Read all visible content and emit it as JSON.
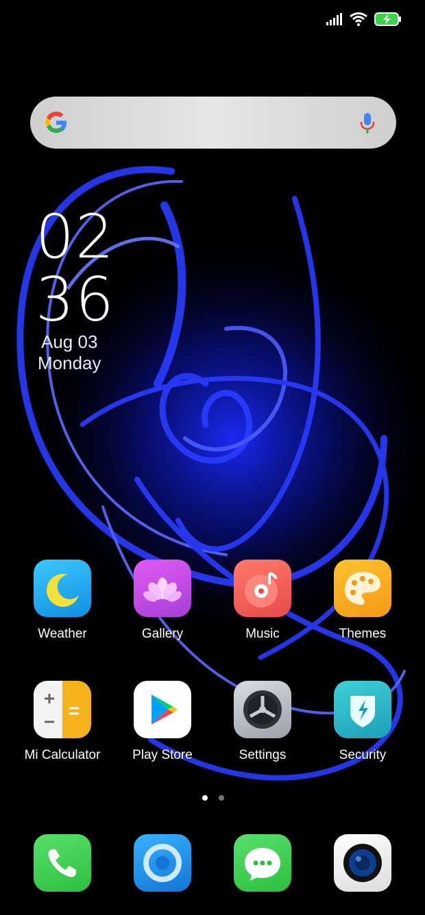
{
  "clock": {
    "hour": "02",
    "minute": "36",
    "date": "Aug 03",
    "day": "Monday"
  },
  "search": {
    "placeholder": ""
  },
  "home_apps": [
    {
      "label": "Weather",
      "icon": "weather-icon",
      "color": "#1aa8f0"
    },
    {
      "label": "Gallery",
      "icon": "gallery-icon",
      "color": "#c54fe3"
    },
    {
      "label": "Music",
      "icon": "music-icon",
      "color": "#f05a5a"
    },
    {
      "label": "Themes",
      "icon": "themes-icon",
      "color": "#f7a51d"
    },
    {
      "label": "Mi Calculator",
      "icon": "calculator-icon",
      "color": "#f3b21c"
    },
    {
      "label": "Play Store",
      "icon": "play-store-icon",
      "color": "#ffffff"
    },
    {
      "label": "Settings",
      "icon": "settings-icon",
      "color": "#8a9099"
    },
    {
      "label": "Security",
      "icon": "security-icon",
      "color": "#2ab6c6"
    }
  ],
  "dock_apps": [
    {
      "icon": "phone-icon",
      "color": "#3bcf4c"
    },
    {
      "icon": "browser-icon",
      "color": "#1b8fe8"
    },
    {
      "icon": "messages-icon",
      "color": "#3bcf4c"
    },
    {
      "icon": "camera-icon",
      "color": "#f2f2f2"
    }
  ],
  "page_indicator": {
    "pages": 2,
    "current": 1
  }
}
